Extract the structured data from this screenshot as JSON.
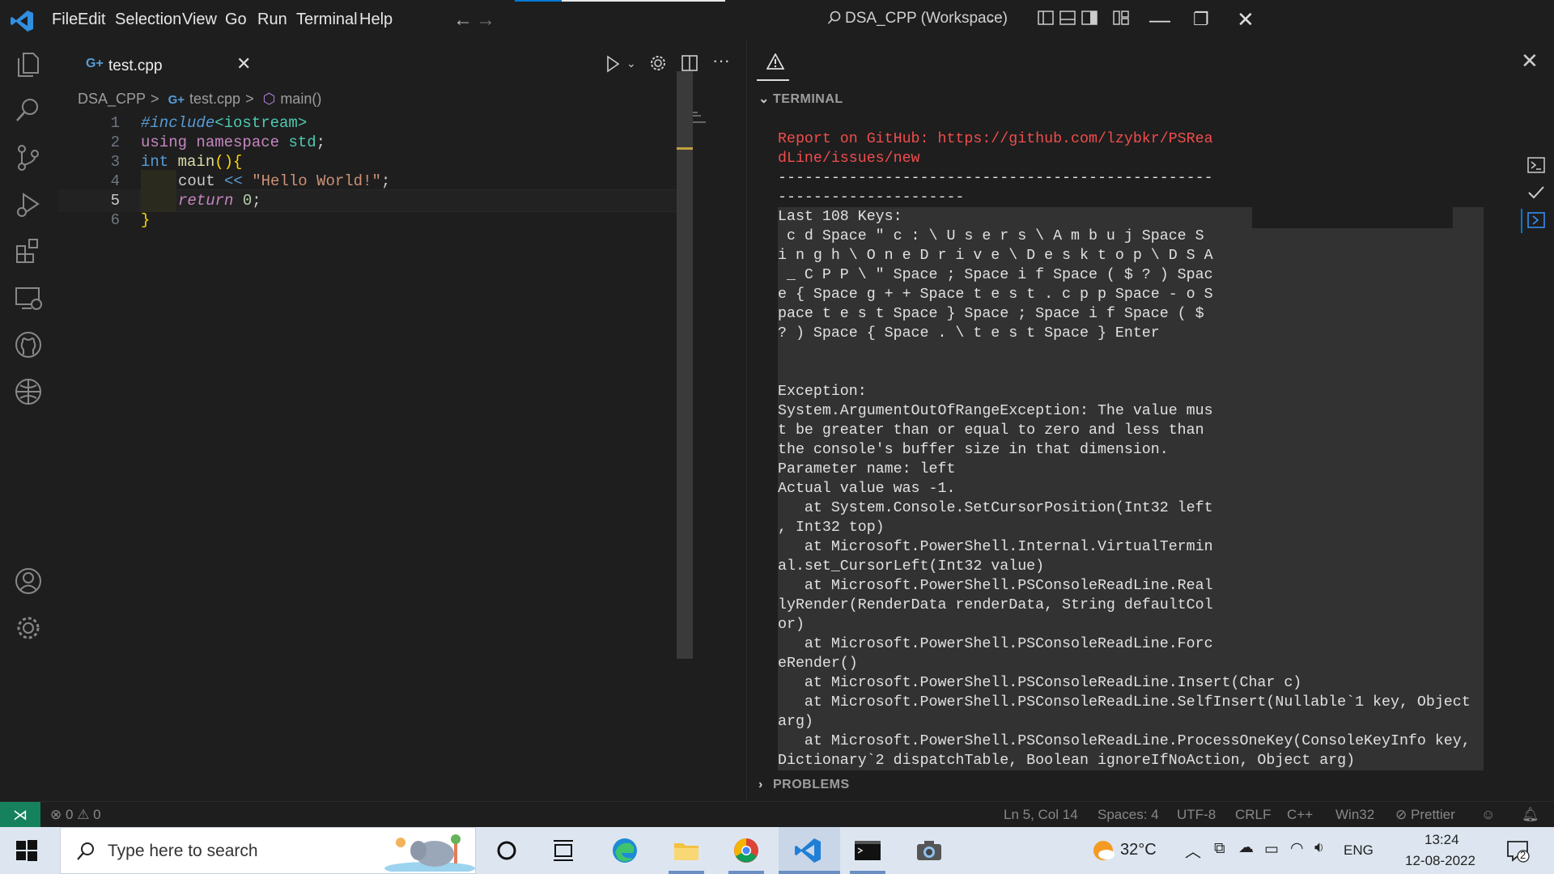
{
  "titlebar": {
    "menu": [
      "File",
      "Edit",
      "Selection",
      "View",
      "Go",
      "Run",
      "Terminal",
      "Help"
    ],
    "command_center": "DSA_CPP (Workspace)"
  },
  "tab": {
    "label": "test.cpp",
    "icon": "G+"
  },
  "breadcrumb": {
    "root": "DSA_CPP",
    "file": "test.cpp",
    "symbol": "main()",
    "sep": ">"
  },
  "code": {
    "line_numbers": [
      "1",
      "2",
      "3",
      "4",
      "5",
      "6"
    ],
    "l1": {
      "a": "#include",
      "b": "<iostream>"
    },
    "l2": {
      "a": "using",
      "b": " namespace ",
      "c": "std",
      ";": ";"
    },
    "l3": {
      "a": "int",
      "b": " main",
      "c": "(){"
    },
    "l4": {
      "a": "cout ",
      "b": "<<",
      "c": " ",
      "d": "\"Hello World!\"",
      "e": ";"
    },
    "l5": {
      "a": "return",
      "b": " ",
      "c": "0",
      "d": ";"
    },
    "l6": {
      "a": "}"
    }
  },
  "panel": {
    "terminal_title": "TERMINAL",
    "problems_title": "PROBLEMS"
  },
  "terminal": {
    "report_lines": [
      "Report on GitHub: https://github.com/lzybkr/PSRea",
      "dLine/issues/new"
    ],
    "body": "-------------------------------------------------\n---------------------\nLast 108 Keys:\n c d Space \" c : \\ U s e r s \\ A m b u j Space S\ni n g h \\ O n e D r i v e \\ D e s k t o p \\ D S A\n _ C P P \\ \" Space ; Space i f Space ( $ ? ) Spac\ne { Space g + + Space t e s t . c p p Space - o S\npace t e s t Space } Space ; Space i f Space ( $\n? ) Space { Space . \\ t e s t Space } Enter\n\n\nException:\nSystem.ArgumentOutOfRangeException: The value mus\nt be greater than or equal to zero and less than\nthe console's buffer size in that dimension.\nParameter name: left\nActual value was -1.\n   at System.Console.SetCursorPosition(Int32 left\n, Int32 top)\n   at Microsoft.PowerShell.Internal.VirtualTermin\nal.set_CursorLeft(Int32 value)\n   at Microsoft.PowerShell.PSConsoleReadLine.Real\nlyRender(RenderData renderData, String defaultCol\nor)\n   at Microsoft.PowerShell.PSConsoleReadLine.Forc\neRender()\n   at Microsoft.PowerShell.PSConsoleReadLine.Insert(Char c)\n   at Microsoft.PowerShell.PSConsoleReadLine.SelfInsert(Nullable`1 key, Object\narg)\n   at Microsoft.PowerShell.PSConsoleReadLine.ProcessOneKey(ConsoleKeyInfo key,\nDictionary`2 dispatchTable, Boolean ignoreIfNoAction, Object arg)"
  },
  "statusbar": {
    "errors": "0",
    "warnings": "0",
    "position": "Ln 5, Col 14",
    "spaces": "Spaces: 4",
    "encoding": "UTF-8",
    "eol": "CRLF",
    "language": "C++",
    "platform": "Win32",
    "formatter": "Prettier"
  },
  "taskbar": {
    "search_placeholder": "Type here to search",
    "temperature": "32°C",
    "language": "ENG",
    "time": "13:24",
    "date": "12-08-2022",
    "notification_count": "2"
  },
  "colors": {
    "accent": "#0078d4",
    "remote": "#16825d",
    "error_text": "#f14c4c"
  }
}
